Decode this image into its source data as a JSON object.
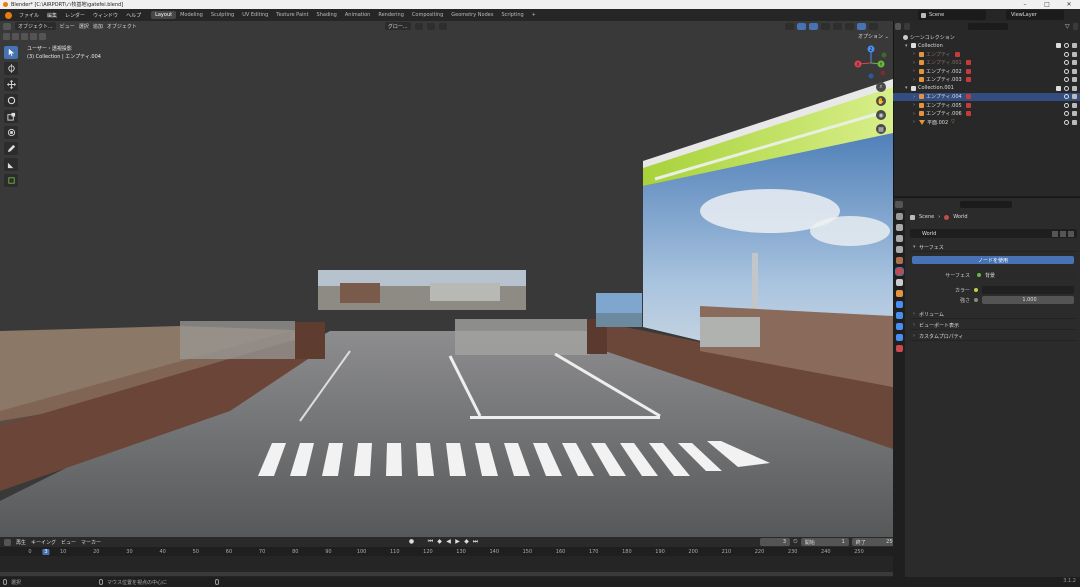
{
  "window": {
    "title": "Blender* [C:\\AIRPORT\\ハ牧基地\\gatefei.blend]",
    "controls": [
      "–",
      "□",
      "✕"
    ]
  },
  "menubar": {
    "menus": [
      "ファイル",
      "編集",
      "レンダー",
      "ウィンドウ",
      "ヘルプ"
    ],
    "workspaces": [
      "Layout",
      "Modeling",
      "Sculpting",
      "UV Editing",
      "Texture Paint",
      "Shading",
      "Animation",
      "Rendering",
      "Compositing",
      "Geometry Nodes",
      "Scripting",
      "+"
    ],
    "active_workspace": "Layout",
    "scene": "Scene",
    "view_layer": "ViewLayer"
  },
  "viewport": {
    "mode": "オブジェクト...",
    "menus": [
      "ビュー",
      "選択",
      "追加",
      "オブジェクト"
    ],
    "transform": "グロー...",
    "info_line1": "ユーザー・透視投影",
    "info_line2": "(3) Collection | エンプティ.004",
    "options_label": "オプション ⌄",
    "gizmo": {
      "x": "X",
      "y": "Y",
      "z": "Z"
    }
  },
  "toolbar": {
    "tools": [
      "select-box",
      "cursor",
      "move",
      "rotate",
      "scale",
      "transform",
      "annotate",
      "measure",
      "add-cube"
    ]
  },
  "timeline": {
    "menus": [
      "再生",
      "キーイング",
      "ビュー",
      "マーカー"
    ],
    "current_frame": "3",
    "start_label": "開始",
    "start": "1",
    "end_label": "終了",
    "end": "250",
    "ticks": [
      "0",
      "10",
      "20",
      "30",
      "40",
      "50",
      "60",
      "70",
      "80",
      "90",
      "100",
      "110",
      "120",
      "130",
      "140",
      "150",
      "160",
      "170",
      "180",
      "190",
      "200",
      "210",
      "220",
      "230",
      "240",
      "250"
    ],
    "current_marker": "3"
  },
  "statusbar": {
    "select": "選択",
    "hint": "マウス位置を視点の中心に",
    "version": "3.1.2"
  },
  "outliner": {
    "rows": [
      {
        "label": "シーンコレクション",
        "icon": "scene",
        "indent": 0,
        "selected": false
      },
      {
        "label": "Collection",
        "icon": "coll",
        "indent": 1,
        "selected": false
      },
      {
        "label": "エンプティ",
        "icon": "empty",
        "indent": 2,
        "selected": false,
        "dim": true
      },
      {
        "label": "エンプティ.001",
        "icon": "empty",
        "indent": 2,
        "selected": false,
        "dim": true
      },
      {
        "label": "エンプティ.002",
        "icon": "empty",
        "indent": 2,
        "selected": false
      },
      {
        "label": "エンプティ.003",
        "icon": "empty",
        "indent": 2,
        "selected": false
      },
      {
        "label": "Collection.001",
        "icon": "coll",
        "indent": 1,
        "selected": false
      },
      {
        "label": "エンプティ.004",
        "icon": "empty",
        "indent": 2,
        "selected": true
      },
      {
        "label": "エンプティ.005",
        "icon": "empty",
        "indent": 2,
        "selected": false
      },
      {
        "label": "エンプティ.006",
        "icon": "empty",
        "indent": 2,
        "selected": false
      },
      {
        "label": "平面.002",
        "icon": "plane",
        "indent": 2,
        "selected": false
      }
    ]
  },
  "properties": {
    "breadcrumb_scene": "Scene",
    "breadcrumb_world": "World",
    "world_name": "World",
    "panel_surface": "サーフェス",
    "use_nodes": "ノードを使用",
    "surface_label": "サーフェス",
    "surface_value": "背景",
    "color_label": "カラー",
    "strength_label": "強さ",
    "strength_value": "1.000",
    "panel_volume": "ボリューム",
    "panel_viewport": "ビューポート表示",
    "panel_custom": "カスタムプロパティ"
  },
  "colors": {
    "accent": "#4772b3",
    "selection": "#334d80",
    "object_orange": "#e0953e",
    "x_axis": "#e04050",
    "y_axis": "#6ab73c",
    "z_axis": "#4a8ff0"
  }
}
